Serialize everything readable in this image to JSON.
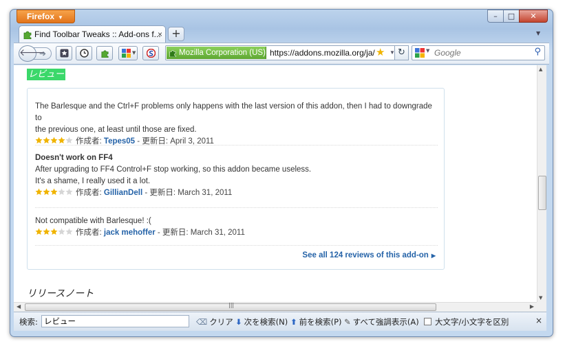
{
  "app": {
    "menu_label": "Firefox",
    "window_controls": {
      "minimize": "–",
      "maximize": "□",
      "close": "✕"
    }
  },
  "tab": {
    "title": "Find Toolbar Tweaks :: Add-ons f...",
    "close": "×",
    "new_tab": "+"
  },
  "nav": {
    "identity": "Mozilla Corporation (US)",
    "url": "https://addons.mozilla.org/ja/",
    "search_placeholder": "Google"
  },
  "page": {
    "reviews_heading": "レビュー",
    "reviews": [
      {
        "title": "",
        "body": [
          "The Barlesque and the Ctrl+F problems only happens with the last version of this addon, then I had to downgrade to",
          "the previous one, at least until those are fixed."
        ],
        "rating": 4,
        "author_prefix": "作成者:",
        "author": "Tepes05",
        "date_text": " - 更新日: April 3, 2011"
      },
      {
        "title": "Doesn't work on FF4",
        "body": [
          "After upgrading to FF4 Control+F stop working, so this addon became useless.",
          "It's a shame, I really used it a lot."
        ],
        "rating": 3,
        "author_prefix": "作成者:",
        "author": "GillianDell",
        "date_text": " - 更新日: March 31, 2011"
      },
      {
        "title": "",
        "body": [
          "Not compatible with Barlesque! :("
        ],
        "rating": 3,
        "author_prefix": "作成者:",
        "author": "jack mehoffer",
        "date_text": " - 更新日: March 31, 2011"
      }
    ],
    "see_all": "See all 124 reviews of this add-on",
    "release_notes_heading": "リリースノート"
  },
  "findbar": {
    "label": "検索:",
    "value": "レビュー",
    "clear": "クリア",
    "next": "次を検索(N)",
    "prev": "前を検索(P)",
    "highlight": "すべて強調表示(A)",
    "match_case": "大文字/小文字を区別",
    "close": "×"
  },
  "colors": {
    "accent": "#e2741b",
    "heading_bg": "#3bd86a",
    "link": "#2563a8",
    "star": "#f0b400"
  }
}
